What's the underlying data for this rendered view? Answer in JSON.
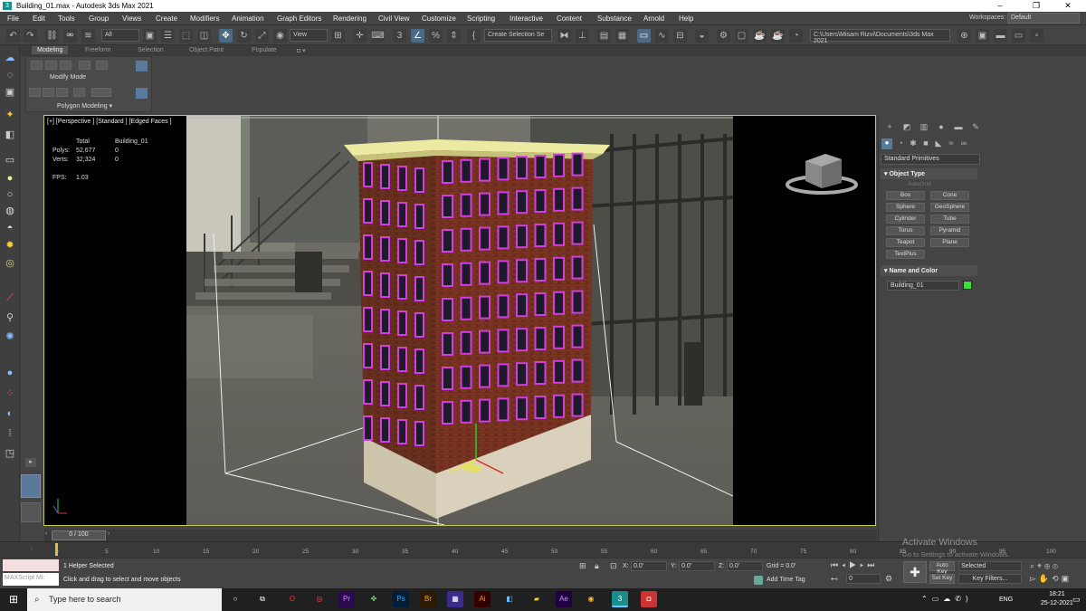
{
  "window": {
    "title": "Building_01.max - Autodesk 3ds Max 2021",
    "minimize": "–",
    "maximize": "❐",
    "close": "✕"
  },
  "menu": [
    "File",
    "Edit",
    "Tools",
    "Group",
    "Views",
    "Create",
    "Modifiers",
    "Animation",
    "Graph Editors",
    "Rendering",
    "Civil View",
    "Customize",
    "Scripting",
    "Interactive",
    "Content",
    "Substance",
    "Arnold",
    "Help"
  ],
  "workspaces": {
    "label": "Workspaces:",
    "value": "Default"
  },
  "toolbar": {
    "filter": "All",
    "ref_coord": "View",
    "selection_set": "Create Selection Se",
    "project_path": "C:\\Users\\Misam Rizvi\\Documents\\3ds Max 2021"
  },
  "ribbon": {
    "tabs": [
      "Modeling",
      "Freeform",
      "Selection",
      "Object Paint",
      "Populate"
    ],
    "active_tab": "Modeling",
    "modify_mode": "Modify Mode",
    "polygon_modeling": "Polygon Modeling ▾"
  },
  "viewport": {
    "label": "[+] [Perspective ] [Standard ] [Edged Faces ]",
    "stats": {
      "total": "Total",
      "object": "Building_01",
      "polys_label": "Polys:",
      "polys_total": "52,677",
      "polys_obj": "0",
      "verts_label": "Verts:",
      "verts_total": "32,324",
      "verts_obj": "0",
      "fps_label": "FPS:",
      "fps": "1.03"
    }
  },
  "command_panel": {
    "category": "Standard Primitives",
    "object_type_header": "Object Type",
    "autogrid": "AutoGrid",
    "buttons": [
      "Box",
      "Cone",
      "Sphere",
      "GeoSphere",
      "Cylinder",
      "Tube",
      "Torus",
      "Pyramid",
      "Teapot",
      "Plane",
      "TextPlus"
    ],
    "name_color_header": "Name and Color",
    "object_name": "Building_01",
    "object_color": "#33e233"
  },
  "timeline": {
    "slider": "0 / 100",
    "ticks": [
      "0",
      "5",
      "10",
      "15",
      "20",
      "25",
      "30",
      "35",
      "40",
      "45",
      "50",
      "55",
      "60",
      "65",
      "70",
      "75",
      "80",
      "85",
      "90",
      "95",
      "100"
    ]
  },
  "status": {
    "maxscript": "MAXScript Mi:",
    "selection": "1 Helper Selected",
    "prompt": "Click and drag to select and move objects",
    "x_label": "X:",
    "x": "0.0'",
    "y_label": "Y:",
    "y": "0.0'",
    "z_label": "Z:",
    "z": "0.0'",
    "grid": "Grid = 0.0'",
    "add_time_tag": "Add Time Tag",
    "auto_key": "Auto Key",
    "set_key": "Set Key",
    "selected": "Selected",
    "key_filters": "Key Filters...",
    "frame": "0"
  },
  "watermark": {
    "title": "Activate Windows",
    "subtitle": "Go to Settings to activate Windows."
  },
  "taskbar": {
    "search_placeholder": "Type here to search",
    "lang": "ENG",
    "time": "18:21",
    "date": "25-12-2021"
  }
}
